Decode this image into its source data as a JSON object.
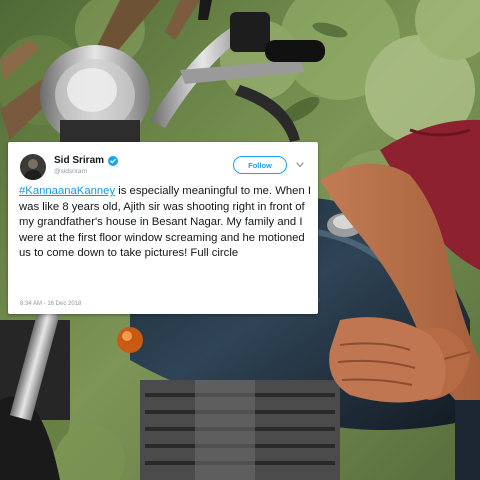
{
  "tweet": {
    "display_name": "Sid Sriram",
    "handle": "@sidsriram",
    "follow_label": "Follow",
    "hashtag": "#KannaanaKanney",
    "text": " is especially meaningful to me. When I was like 8 years old, Ajith sir was shooting right in front of my grandfather's house in Besant Nagar. My family and I were at the first floor window screaming and he motioned us to come down to take pictures! Full circle",
    "timestamp": "8:34 AM - 16 Dec 2018"
  },
  "colors": {
    "accent": "#1da1f2",
    "hashtag": "#1b95e0",
    "verified": "#1da1f2",
    "text": "#14171a",
    "muted": "#8899a6"
  },
  "icons": [
    "verified-badge-icon",
    "chevron-down-icon",
    "avatar"
  ]
}
